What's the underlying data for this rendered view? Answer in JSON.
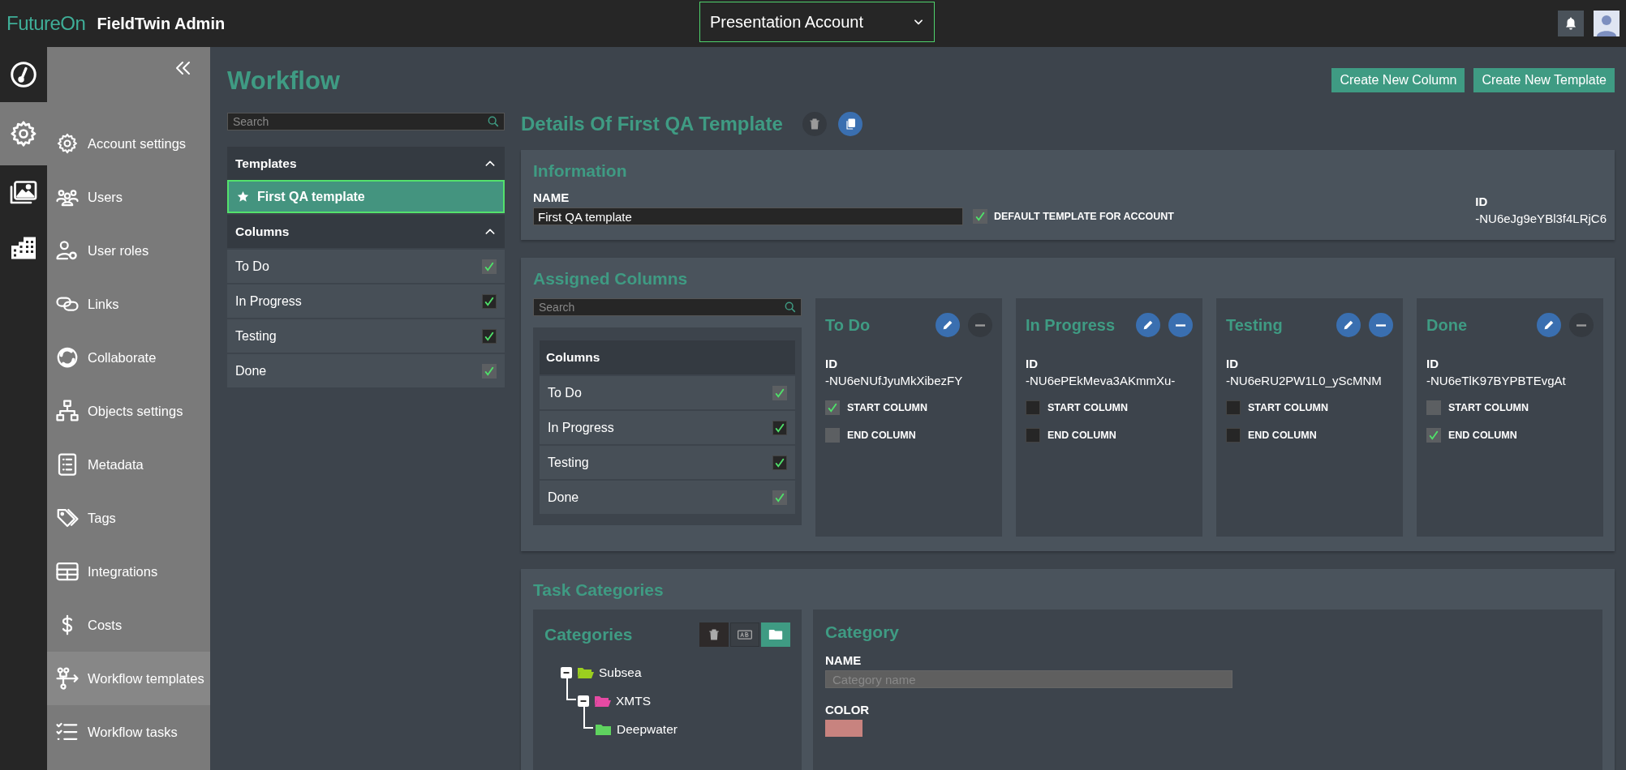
{
  "app": {
    "brand": "FutureOn",
    "title": "FieldTwin Admin"
  },
  "account_select": {
    "value": "Presentation Account"
  },
  "rail": [
    {
      "kind": "dashboard",
      "selected": false
    },
    {
      "kind": "settings",
      "selected": true
    },
    {
      "kind": "gallery",
      "selected": false
    },
    {
      "kind": "buildings",
      "selected": false
    }
  ],
  "sidebar": {
    "items": [
      {
        "kind": "gear",
        "label": "Account settings",
        "selected": false
      },
      {
        "kind": "users",
        "label": "Users",
        "selected": false
      },
      {
        "kind": "user-gear",
        "label": "User roles",
        "selected": false
      },
      {
        "kind": "link",
        "label": "Links",
        "selected": false
      },
      {
        "kind": "collaborate",
        "label": "Collaborate",
        "selected": false
      },
      {
        "kind": "sitemap",
        "label": "Objects settings",
        "selected": false
      },
      {
        "kind": "list",
        "label": "Metadata",
        "selected": false
      },
      {
        "kind": "tag",
        "label": "Tags",
        "selected": false
      },
      {
        "kind": "table",
        "label": "Integrations",
        "selected": false
      },
      {
        "kind": "dollar",
        "label": "Costs",
        "selected": false
      },
      {
        "kind": "workflow",
        "label": "Workflow templates",
        "selected": true
      },
      {
        "kind": "checklist",
        "label": "Workflow tasks",
        "selected": false
      }
    ]
  },
  "page": {
    "title": "Workflow",
    "buttons": [
      "Create New Column",
      "Create New Template"
    ]
  },
  "template_list": {
    "search": {
      "placeholder": "Search"
    },
    "templates_header": {
      "label": "Templates",
      "expanded": true
    },
    "templates": [
      {
        "label": "First QA template",
        "default": true,
        "selected": true
      }
    ],
    "columns_header": {
      "label": "Columns",
      "expanded": true
    },
    "columns": [
      {
        "label": "To Do",
        "checked": true,
        "disabled": true
      },
      {
        "label": "In Progress",
        "checked": true,
        "disabled": false
      },
      {
        "label": "Testing",
        "checked": true,
        "disabled": false
      },
      {
        "label": "Done",
        "checked": true,
        "disabled": true
      }
    ]
  },
  "details": {
    "title": "Details Of First QA Template",
    "information": {
      "title": "Information",
      "name_label": "NAME",
      "name_value": "First QA template",
      "default_checkbox": {
        "label": "DEFAULT TEMPLATE FOR ACCOUNT",
        "checked": true,
        "disabled": true
      },
      "id_label": "ID",
      "id_value": "-NU6eJg9eYBl3f4LRjC6"
    },
    "assigned": {
      "title": "Assigned Columns",
      "search": {
        "placeholder": "Search"
      },
      "list_header": "Columns",
      "list": [
        {
          "label": "To Do",
          "checked": true,
          "disabled": true
        },
        {
          "label": "In Progress",
          "checked": true,
          "disabled": false
        },
        {
          "label": "Testing",
          "checked": true,
          "disabled": false
        },
        {
          "label": "Done",
          "checked": true,
          "disabled": true
        }
      ],
      "cards": [
        {
          "title": "To Do",
          "remove_disabled": true,
          "id_label": "ID",
          "id_value": "-NU6eNUfJyuMkXibezFY",
          "options": [
            {
              "label": "START COLUMN",
              "checked": true,
              "disabled": true
            },
            {
              "label": "END COLUMN",
              "checked": false,
              "disabled": true
            }
          ]
        },
        {
          "title": "In Progress",
          "remove_disabled": false,
          "id_label": "ID",
          "id_value": "-NU6ePEkMeva3AKmmXu-",
          "options": [
            {
              "label": "START COLUMN",
              "checked": false,
              "disabled": false
            },
            {
              "label": "END COLUMN",
              "checked": false,
              "disabled": false
            }
          ]
        },
        {
          "title": "Testing",
          "remove_disabled": false,
          "id_label": "ID",
          "id_value": "-NU6eRU2PW1L0_yScMNM",
          "options": [
            {
              "label": "START COLUMN",
              "checked": false,
              "disabled": false
            },
            {
              "label": "END COLUMN",
              "checked": false,
              "disabled": false
            }
          ]
        },
        {
          "title": "Done",
          "remove_disabled": true,
          "id_label": "ID",
          "id_value": "-NU6eTlK97BYPBTEvgAt",
          "options": [
            {
              "label": "START COLUMN",
              "checked": false,
              "disabled": true
            },
            {
              "label": "END COLUMN",
              "checked": true,
              "disabled": true
            }
          ]
        }
      ]
    },
    "task_categories": {
      "title": "Task Categories",
      "tree_title": "Categories",
      "tools": [
        {
          "kind": "delete",
          "selected": false
        },
        {
          "kind": "rename",
          "selected": false
        },
        {
          "kind": "folder",
          "selected": true
        }
      ],
      "tree": [
        {
          "label": "Subsea",
          "color": "#9bcf1f",
          "expanded": true,
          "children": [
            {
              "label": "XMTS",
              "color": "#e64aa3",
              "expanded": true,
              "children": [
                {
                  "label": "Deepwater",
                  "color": "#5fd35f",
                  "expanded": false
                }
              ]
            }
          ]
        }
      ],
      "form": {
        "title": "Category",
        "name_label": "NAME",
        "name_placeholder": "Category name",
        "color_label": "COLOR",
        "color": "#c8837f"
      }
    }
  }
}
